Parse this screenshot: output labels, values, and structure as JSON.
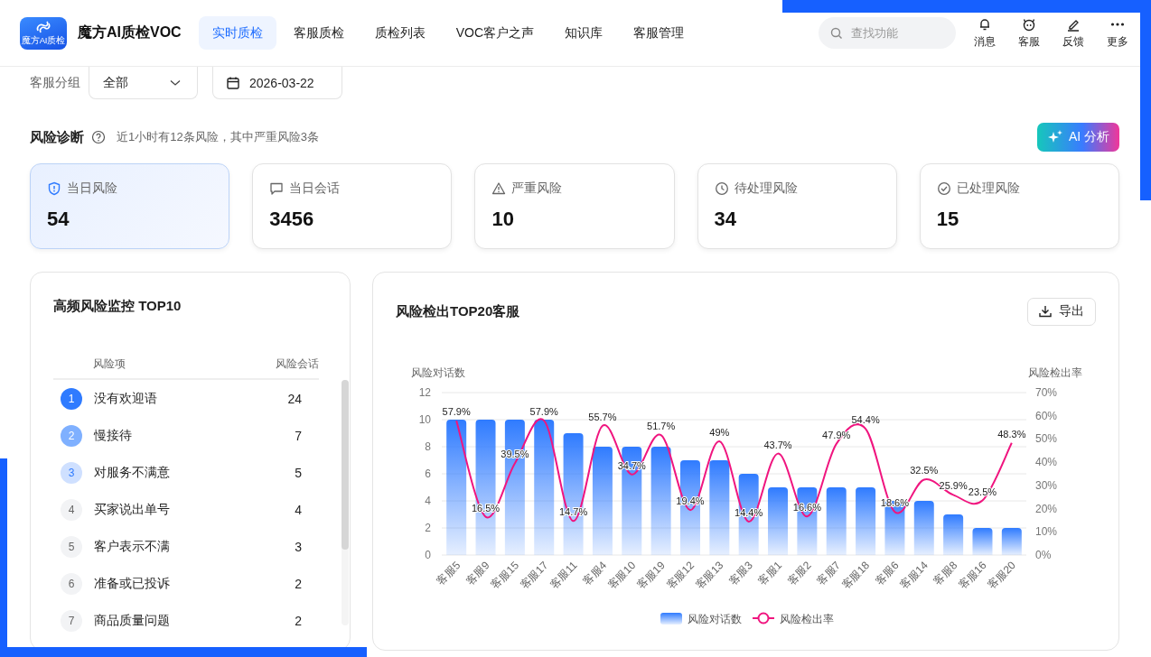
{
  "app": {
    "name": "魔方AI质检VOC",
    "logo_text": "魔方AI质检"
  },
  "nav": [
    {
      "label": "实时质检",
      "selected": true
    },
    {
      "label": "客服质检",
      "selected": false
    },
    {
      "label": "质检列表",
      "selected": false
    },
    {
      "label": "VOC客户之声",
      "selected": false
    },
    {
      "label": "知识库",
      "selected": false
    },
    {
      "label": "客服管理",
      "selected": false
    }
  ],
  "search": {
    "placeholder": "查找功能"
  },
  "toolbar": [
    {
      "kind": "bell",
      "label": "消息"
    },
    {
      "kind": "agent",
      "label": "客服"
    },
    {
      "kind": "pen",
      "label": "反馈"
    },
    {
      "kind": "more",
      "label": "更多"
    }
  ],
  "filters": {
    "group_label": "客服分组",
    "group_value": "全部",
    "date": "2026-03-22"
  },
  "diagnosis": {
    "title": "风险诊断",
    "summary": "近1小时有12条风险，其中严重风险3条",
    "ai_button": "AI 分析"
  },
  "stats": [
    {
      "kind": "shield",
      "label": "当日风险",
      "value": "54",
      "selected": true
    },
    {
      "kind": "chat",
      "label": "当日会话",
      "value": "3456",
      "selected": false
    },
    {
      "kind": "warning",
      "label": "严重风险",
      "value": "10",
      "selected": false
    },
    {
      "kind": "clock",
      "label": "待处理风险",
      "value": "34",
      "selected": false
    },
    {
      "kind": "check",
      "label": "已处理风险",
      "value": "15",
      "selected": false
    }
  ],
  "top_risks": {
    "title": "高频风险监控 TOP10",
    "columns": [
      "风险项",
      "风险会话"
    ],
    "rows": [
      {
        "rank": "1",
        "name": "没有欢迎语",
        "count": "24"
      },
      {
        "rank": "2",
        "name": "慢接待",
        "count": "7"
      },
      {
        "rank": "3",
        "name": "对服务不满意",
        "count": "5"
      },
      {
        "rank": "4",
        "name": "买家说出单号",
        "count": "4"
      },
      {
        "rank": "5",
        "name": "客户表示不满",
        "count": "3"
      },
      {
        "rank": "6",
        "name": "准备或已投诉",
        "count": "2"
      },
      {
        "rank": "7",
        "name": "商品质量问题",
        "count": "2"
      }
    ]
  },
  "chart_panel": {
    "title": "风险检出TOP20客服",
    "export_button": "导出",
    "count_chart": {
      "chart_data": {
        "type": "bar",
        "ylabel": "风险对话数",
        "grid": true,
        "legend": "bottom",
        "categories": [
          "客服5",
          "客服9",
          "客服15",
          "客服17",
          "客服11",
          "客服4",
          "客服10",
          "客服19",
          "客服12",
          "客服13",
          "客服3",
          "客服1",
          "客服2",
          "客服7",
          "客服18",
          "客服6",
          "客服14",
          "客服8",
          "客服16",
          "客服20"
        ],
        "ylim": [
          0,
          12
        ],
        "yticks": [
          0,
          2,
          4,
          6,
          8,
          10,
          12
        ],
        "series": [
          {
            "name": "风险对话数",
            "color": "#2f7bff",
            "values": [
              10,
              10,
              10,
              10,
              9,
              8,
              8,
              8,
              7,
              7,
              6,
              5,
              5,
              5,
              5,
              4,
              4,
              3,
              2,
              2
            ]
          }
        ]
      }
    },
    "rate_chart": {
      "chart_data": {
        "type": "line",
        "ylabel": "风险检出率",
        "ylim": [
          0,
          70
        ],
        "yticks": [
          {
            "value": 0,
            "label": "0%"
          },
          {
            "value": 10,
            "label": "10%"
          },
          {
            "value": 20,
            "label": "20%"
          },
          {
            "value": 30,
            "label": "30%"
          },
          {
            "value": 40,
            "label": "40%"
          },
          {
            "value": 50,
            "label": "50%"
          },
          {
            "value": 60,
            "label": "60%"
          },
          {
            "value": 70,
            "label": "70%"
          }
        ],
        "series": [
          {
            "name": "风险检出率",
            "color": "#f0157f",
            "values": [
              57.9,
              16.5,
              39.5,
              57.9,
              14.7,
              55.7,
              34.7,
              51.7,
              19.4,
              49,
              14.4,
              43.7,
              16.6,
              47.9,
              54.4,
              18.6,
              32.5,
              25.9,
              23.5,
              48.3
            ],
            "value_labels": [
              "57.9%",
              "16.5%",
              "39.5%",
              "57.9%",
              "14.7%",
              "55.7%",
              "34.7%",
              "51.7%",
              "19.4%",
              "49%",
              "14.4%",
              "43.7%",
              "16.6%",
              "47.9%",
              "54.4%",
              "18.6%",
              "32.5%",
              "25.9%",
              "23.5%",
              "48.3%"
            ]
          }
        ]
      }
    }
  }
}
